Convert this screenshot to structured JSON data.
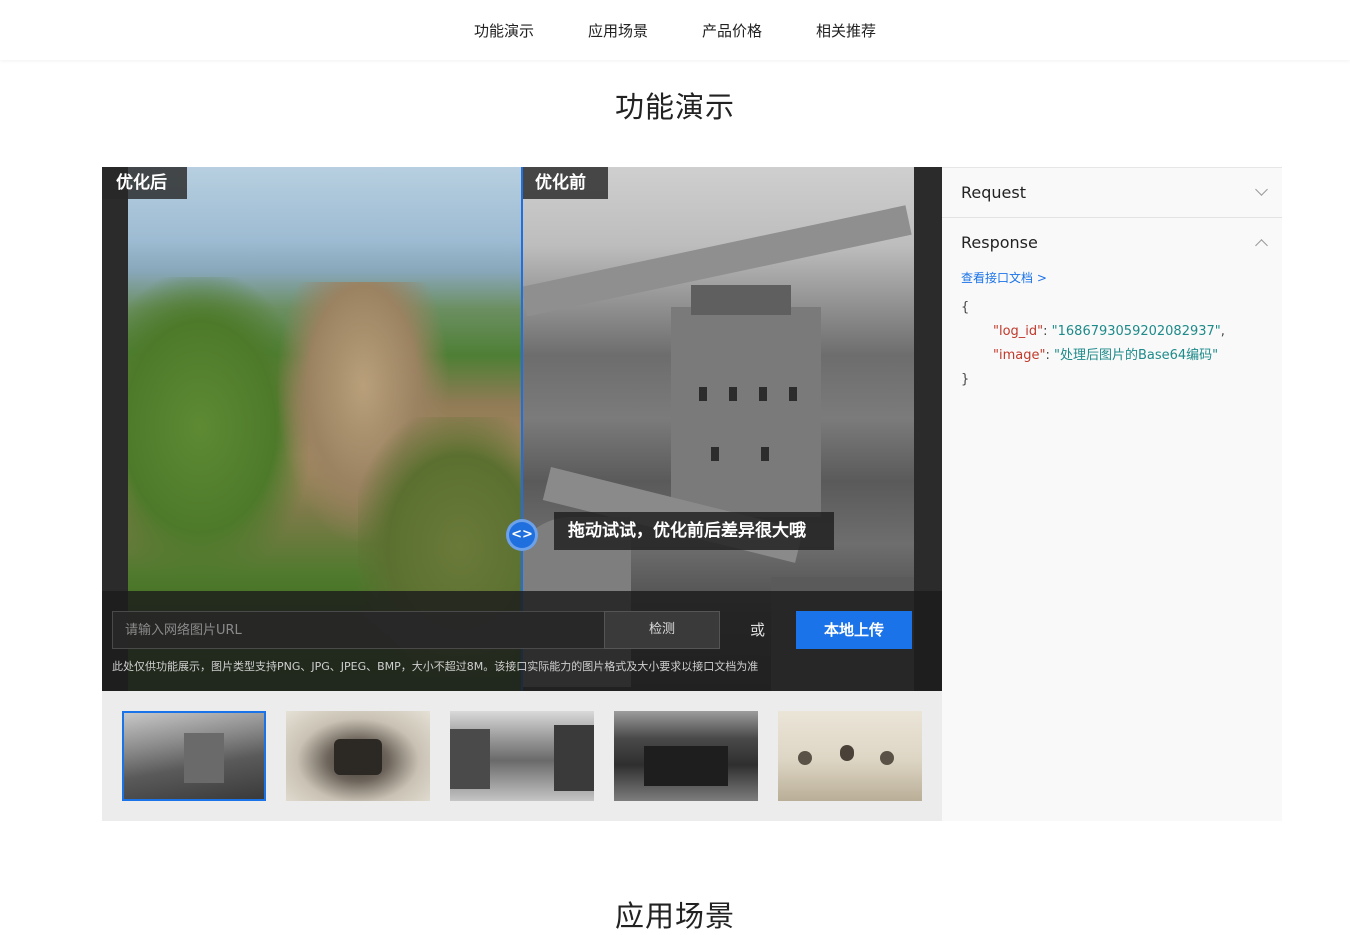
{
  "nav": {
    "items": [
      "功能演示",
      "应用场景",
      "产品价格",
      "相关推荐"
    ]
  },
  "sections": {
    "demo_title": "功能演示",
    "next_title": "应用场景"
  },
  "demo": {
    "after_label": "优化后",
    "before_label": "优化前",
    "drag_hint": "拖动试试，优化前后差异很大哦",
    "handle_glyph": "<>",
    "url_placeholder": "请输入网络图片URL",
    "detect_label": "检测",
    "or_label": "或",
    "upload_label": "本地上传",
    "notice": "此处仅供功能展示，图片类型支持PNG、JPG、JPEG、BMP，大小不超过8M。该接口实际能力的图片格式及大小要求以接口文档为准",
    "selected_thumbnail": 0
  },
  "panel": {
    "request_label": "Request",
    "response_label": "Response",
    "doc_link": "查看接口文档 >",
    "open_brace": "{",
    "close_brace": "}",
    "fields": [
      {
        "key": "\"log_id\"",
        "sep": ": ",
        "value": "\"1686793059202082937\"",
        "end": ","
      },
      {
        "key": "\"image\"",
        "sep": ": ",
        "value": "\"处理后图片的Base64编码\"",
        "end": ""
      }
    ]
  },
  "colors": {
    "accent": "#1a73e8",
    "json_key": "#c0392b",
    "json_value": "#1f8a8a"
  }
}
